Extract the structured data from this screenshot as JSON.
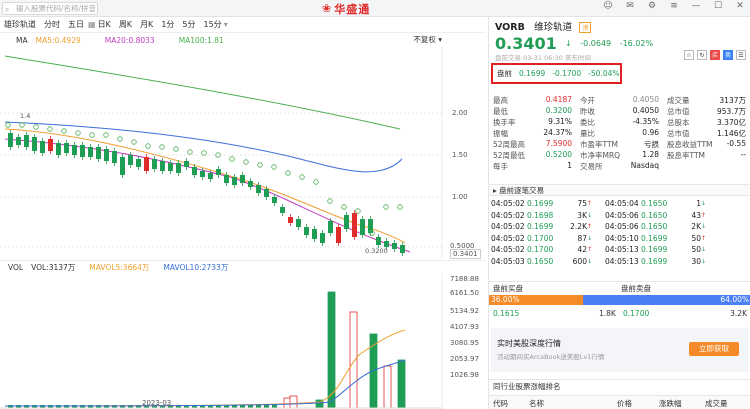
{
  "topbar": {
    "search_placeholder": "输入股票代码/名称/拼音",
    "brand": "华盛通",
    "window_icons": [
      "user-icon",
      "mail-icon",
      "settings-icon",
      "menu-icon",
      "minimize-icon",
      "maximize-icon",
      "close-icon"
    ]
  },
  "timeframes": {
    "items": [
      "雄珍轨道",
      "分时",
      "五日",
      "日K",
      "周K",
      "月K",
      "1分",
      "5分",
      "15分"
    ],
    "active": "日K"
  },
  "ma_legend": {
    "label": "MA",
    "ma5": "MA5:0.4929",
    "ma20": "MA20:0.8033",
    "ma100": "MA100:1.81",
    "adjust": "不复权",
    "colors": {
      "ma5": "#f0a030",
      "ma20": "#c040c0",
      "ma100": "#4caf50",
      "ma_blue": "#3a6fd8"
    }
  },
  "price_axis": [
    "2.00",
    "1.50",
    "1.00",
    "0.5000",
    "0.3401"
  ],
  "low_marker": "0.3200",
  "high_marker": "1.4",
  "vol_legend": {
    "label": "VOL",
    "vol": "VOL:3137万",
    "mavol5": "MAVOL5:3664万",
    "mavol10": "MAVOL10:2733万"
  },
  "vol_axis": [
    "7188.88",
    "6161.50",
    "5134.92",
    "4107.93",
    "3080.95",
    "2053.97",
    "1026.98"
  ],
  "date_label": "2023-03",
  "quote": {
    "symbol": "VORB",
    "name": "维珍轨道",
    "tag": "港",
    "price": "0.3401",
    "change": "-0.0649",
    "change_pct": "-16.02%",
    "sub": "盘前交易 03-31 06:30 美东时间",
    "tools": [
      "☆",
      "↻",
      "买",
      "卖",
      "☰"
    ]
  },
  "premarket": {
    "label": "盘前",
    "price": "0.1699",
    "change": "-0.1700",
    "pct": "-50.04%"
  },
  "stats": [
    [
      [
        "最高",
        "0.4187",
        "red"
      ],
      [
        "今开",
        "0.4050",
        "muted"
      ],
      [
        "成交量",
        "3137万",
        "dark"
      ]
    ],
    [
      [
        "最低",
        "0.3200",
        "green"
      ],
      [
        "昨收",
        "0.4050",
        "dark"
      ],
      [
        "总市值",
        "953.7万",
        "dark"
      ]
    ],
    [
      [
        "换手率",
        "9.31%",
        "dark"
      ],
      [
        "委比",
        "-4.35%",
        "dark"
      ],
      [
        "总股本",
        "3.370亿",
        "dark"
      ]
    ],
    [
      [
        "振幅",
        "24.37%",
        "dark"
      ],
      [
        "量比",
        "0.96",
        "dark"
      ],
      [
        "总市值",
        "1.146亿",
        "dark"
      ]
    ],
    [
      [
        "52周最高",
        "7.5900",
        "red"
      ],
      [
        "市盈率TTM",
        "亏损",
        "dark"
      ],
      [
        "股息收益TTM",
        "-0.55",
        "dark"
      ]
    ],
    [
      [
        "52周最低",
        "0.5200",
        "green"
      ],
      [
        "市净率MRQ",
        "1.28",
        "dark"
      ],
      [
        "股息率TTM",
        "--",
        "dark"
      ]
    ],
    [
      [
        "每手",
        "1",
        "dark"
      ],
      [
        "交易所",
        "Nasdaq",
        "dark"
      ],
      [
        "",
        "",
        "dark"
      ]
    ]
  ],
  "trades_title": "盘前逐笔交易",
  "trades": [
    [
      "04:05:02",
      "0.1699",
      "75",
      "",
      "04:05:04",
      "0.1650",
      "1"
    ],
    [
      "04:05:02",
      "0.1698",
      "3K",
      "",
      "04:05:06",
      "0.1650",
      "43"
    ],
    [
      "04:05:02",
      "0.1699",
      "2.2K",
      "",
      "04:05:06",
      "0.1650",
      "2K"
    ],
    [
      "04:05:02",
      "0.1700",
      "87",
      "",
      "04:05:10",
      "0.1699",
      "50"
    ],
    [
      "04:05:02",
      "0.1700",
      "42",
      "",
      "04:05:13",
      "0.1699",
      "50"
    ],
    [
      "04:05:03",
      "0.1650",
      "600",
      "",
      "04:05:13",
      "0.1699",
      "30"
    ]
  ],
  "trade_dirs": [
    "red",
    "green",
    "green",
    "red",
    "red",
    "green",
    "green",
    "red",
    "red",
    "green",
    "green",
    "green"
  ],
  "bidask": {
    "buy_label": "盘前买盘",
    "sell_label": "盘前卖盘",
    "buy_pct": "36.00%",
    "sell_pct": "64.00%",
    "buy_ratio": 0.36,
    "bid_price": "0.1615",
    "bid_size": "1.8K",
    "ask_price": "0.1700",
    "ask_size": "3.2K"
  },
  "promo": {
    "title": "实时美股深度行情",
    "subtitle": "活动期间买ArcaBook送美股Lv1行情",
    "button": "立即获取"
  },
  "industry": {
    "title": "同行业股票涨幅排名",
    "columns": [
      "代码",
      "名称",
      "价格",
      "涨跌幅",
      "成交量"
    ]
  }
}
